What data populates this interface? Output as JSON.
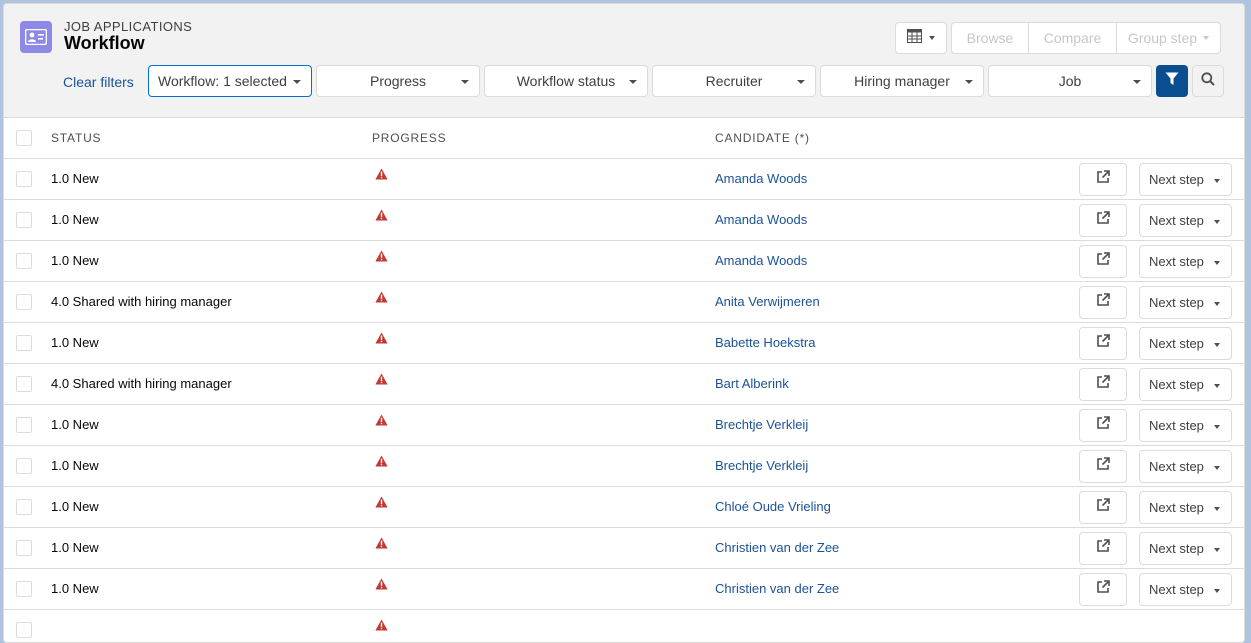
{
  "header": {
    "eyebrow": "JOB APPLICATIONS",
    "title": "Workflow",
    "buttons": {
      "browse": "Browse",
      "compare": "Compare",
      "group_step": "Group step"
    }
  },
  "filters": {
    "clear": "Clear filters",
    "workflow": "Workflow: 1 selected",
    "progress": "Progress",
    "workflow_status": "Workflow status",
    "recruiter": "Recruiter",
    "hiring_manager": "Hiring manager",
    "job": "Job"
  },
  "table": {
    "columns": {
      "status": "STATUS",
      "progress": "PROGRESS",
      "candidate": "CANDIDATE (*)"
    },
    "next_step_label": "Next step",
    "rows": [
      {
        "status": "1.0 New",
        "candidate": "Amanda Woods"
      },
      {
        "status": "1.0 New",
        "candidate": "Amanda Woods"
      },
      {
        "status": "1.0 New",
        "candidate": "Amanda Woods"
      },
      {
        "status": "4.0 Shared with hiring manager",
        "candidate": "Anita Verwijmeren"
      },
      {
        "status": "1.0 New",
        "candidate": "Babette Hoekstra"
      },
      {
        "status": "4.0 Shared with hiring manager",
        "candidate": "Bart Alberink"
      },
      {
        "status": "1.0 New",
        "candidate": "Brechtje Verkleij"
      },
      {
        "status": "1.0 New",
        "candidate": "Brechtje Verkleij"
      },
      {
        "status": "1.0 New",
        "candidate": "Chloé Oude Vrieling"
      },
      {
        "status": "1.0 New",
        "candidate": "Christien van der Zee"
      },
      {
        "status": "1.0 New",
        "candidate": "Christien van der Zee"
      },
      {
        "status": "",
        "candidate": ""
      }
    ]
  },
  "colors": {
    "accent": "#0b4e8f",
    "link": "#1b5297",
    "warning": "#c23934",
    "object_icon": "#8e89e6"
  },
  "icons": {
    "object": "contact-card-icon",
    "view": "table-grid-icon",
    "filter": "funnel-icon",
    "search": "search-icon",
    "progress_warning": "warning-triangle-icon",
    "open": "external-link-icon"
  }
}
